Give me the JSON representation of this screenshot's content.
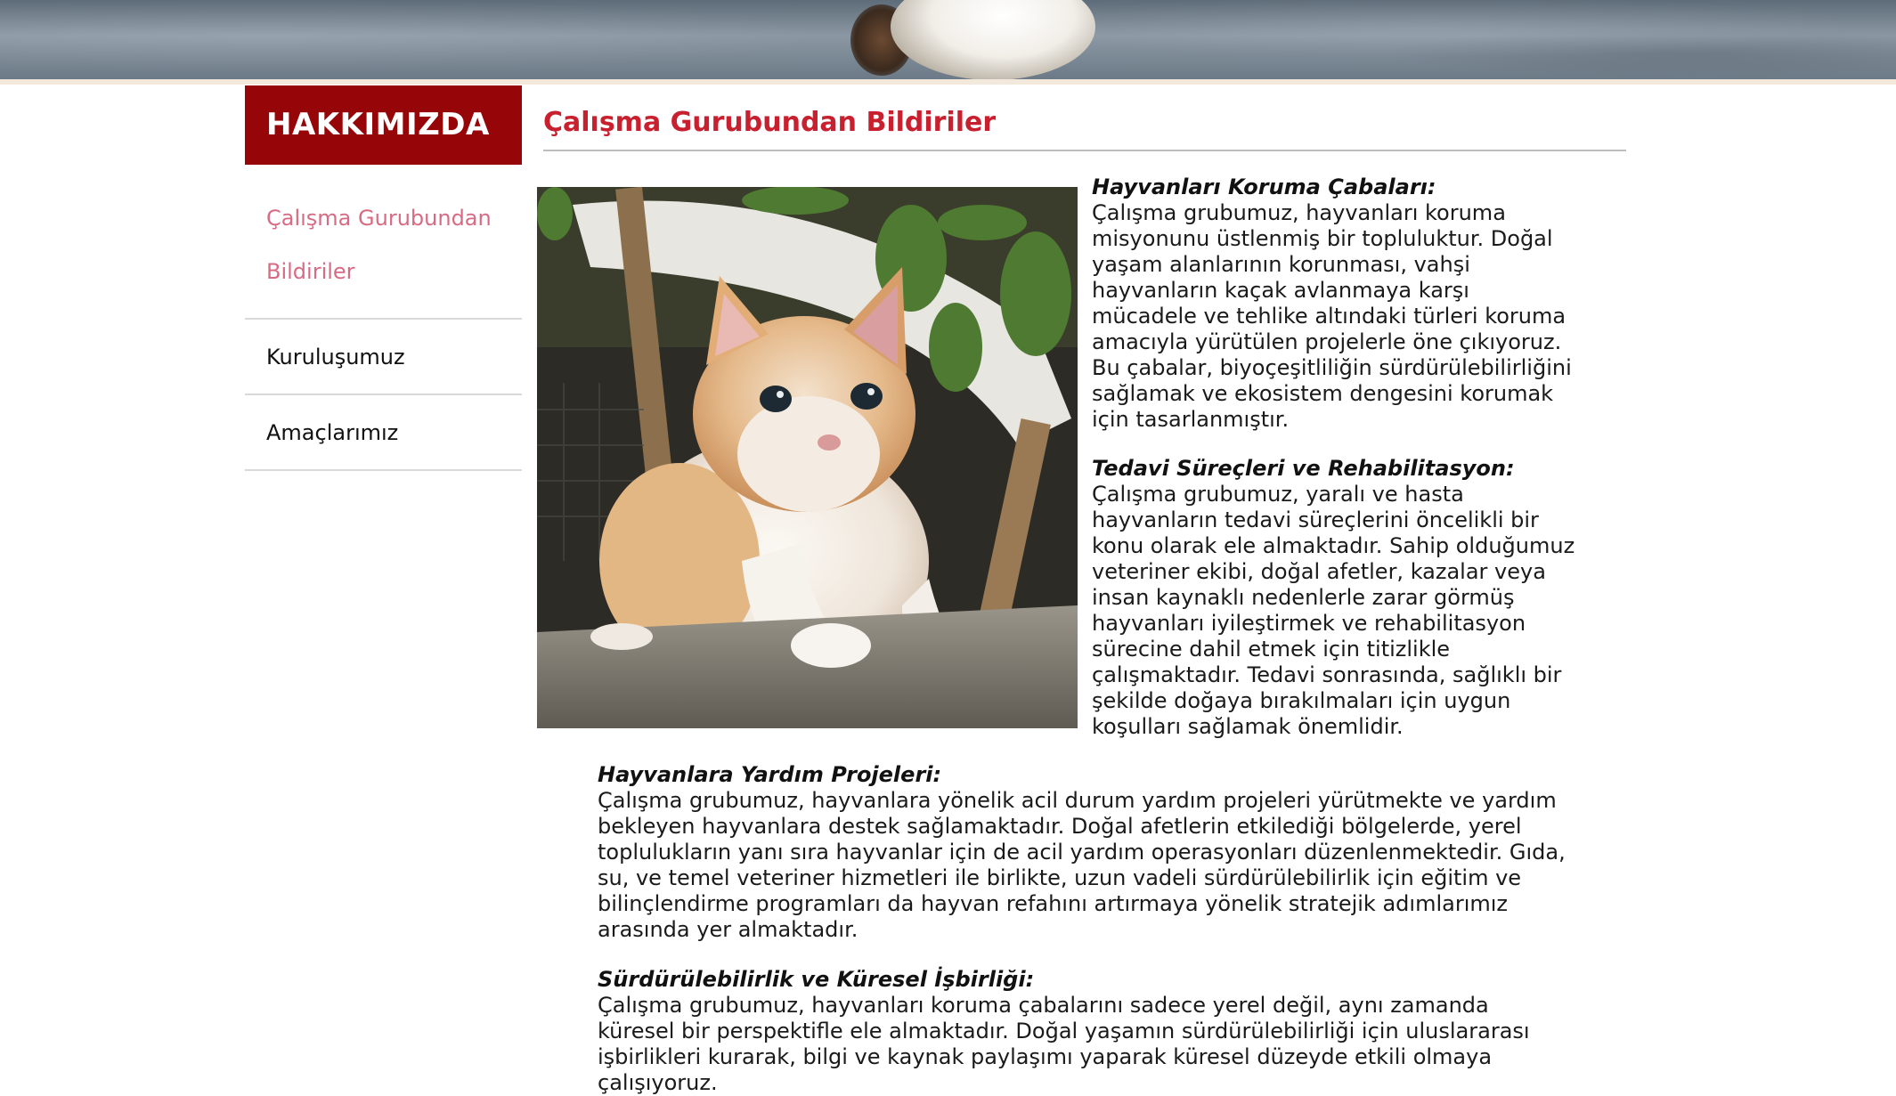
{
  "sidebar": {
    "header": "HAKKIMIZDA",
    "items": [
      {
        "label": "Çalışma Gurubundan Bildiriler",
        "active": true
      },
      {
        "label": "Kuruluşumuz",
        "active": false
      },
      {
        "label": "Amaçlarımız",
        "active": false
      }
    ]
  },
  "main": {
    "title": "Çalışma Gurubundan Bildiriler",
    "sections": [
      {
        "heading": "Hayvanları Koruma Çabaları:",
        "body": "Çalışma grubumuz, hayvanları koruma misyonunu üstlenmiş bir topluluktur. Doğal yaşam alanlarının korunması, vahşi hayvanların kaçak avlanmaya karşı mücadele ve tehlike altındaki türleri koruma amacıyla yürütülen projelerle öne çıkıyoruz. Bu çabalar, biyoçeşitliliğin sürdürülebilirliğini sağlamak ve ekosistem dengesini korumak için tasarlanmıştır."
      },
      {
        "heading": "Tedavi Süreçleri ve Rehabilitasyon:",
        "body": "Çalışma grubumuz, yaralı ve hasta hayvanların tedavi süreçlerini öncelikli bir konu olarak ele almaktadır. Sahip olduğumuz veteriner ekibi, doğal afetler, kazalar veya insan kaynaklı nedenlerle zarar görmüş hayvanları iyileştirmek ve rehabilitasyon sürecine dahil etmek için titizlikle çalışmaktadır. Tedavi sonrasında, sağlıklı bir şekilde doğaya bırakılmaları için uygun koşulları sağlamak önemlidir."
      },
      {
        "heading": "Hayvanlara Yardım Projeleri:",
        "body": "Çalışma grubumuz, hayvanlara yönelik acil durum yardım projeleri yürütmekte ve yardım bekleyen hayvanlara destek sağlamaktadır. Doğal afetlerin etkilediği bölgelerde, yerel toplulukların yanı sıra hayvanlar için de acil yardım operasyonları düzenlenmektedir. Gıda, su, ve temel veteriner hizmetleri ile birlikte, uzun vadeli sürdürülebilirlik için eğitim ve bilinçlendirme programları da hayvan refahını artırmaya yönelik stratejik adımlarımız arasında yer almaktadır."
      },
      {
        "heading": "Sürdürülebilirlik ve Küresel İşbirliği:",
        "body": "Çalışma grubumuz, hayvanları koruma çabalarını sadece yerel değil, aynı zamanda küresel bir perspektifle ele almaktadır. Doğal yaşamın sürdürülebilirliği için uluslararası işbirlikleri kurarak, bilgi ve kaynak paylaşımı yaparak küresel düzeyde etkili olmaya çalışıyoruz."
      }
    ]
  },
  "image": {
    "icon": "kitten-photo"
  },
  "colors": {
    "sidebar_header_bg": "#960508",
    "active_link": "#d86b84",
    "title": "#c8202f"
  }
}
